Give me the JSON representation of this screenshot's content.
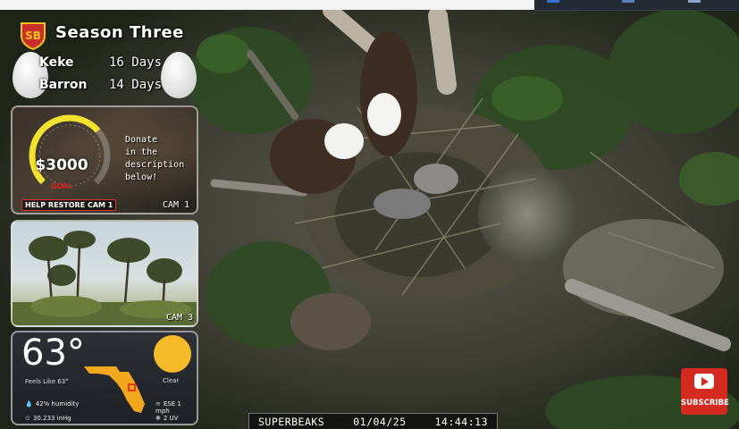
{
  "overlay": {
    "logo_text": "SB",
    "season_title": "Season Three",
    "eaglets": [
      {
        "name": "Keke",
        "age": "16 Days"
      },
      {
        "name": "Barron",
        "age": "14 Days"
      }
    ]
  },
  "donation": {
    "amount": "$3000",
    "goal_label": "GOAL",
    "message": [
      "Donate",
      "in the",
      "description",
      "below!"
    ],
    "button_label": "HELP RESTORE CAM 1",
    "cam_label": "CAM 1",
    "progress": 0.68
  },
  "cam3": {
    "cam_label": "CAM 3"
  },
  "weather": {
    "temperature": "63°",
    "feels_like": "Feels Like 63°",
    "condition": "Clear",
    "humidity": "42% humidity",
    "wind": "ESE 1 mph",
    "pressure": "30.233 inHg",
    "uv": "2 UV"
  },
  "status_bar": {
    "brand": "SUPERBEAKS",
    "date": "01/04/25",
    "time": "14:44:13"
  },
  "subscribe": {
    "label": "SUBSCRIBE"
  },
  "colors": {
    "sun": "#f5b92a",
    "subscribe": "#d42a20",
    "gauge": "#f2e230"
  }
}
